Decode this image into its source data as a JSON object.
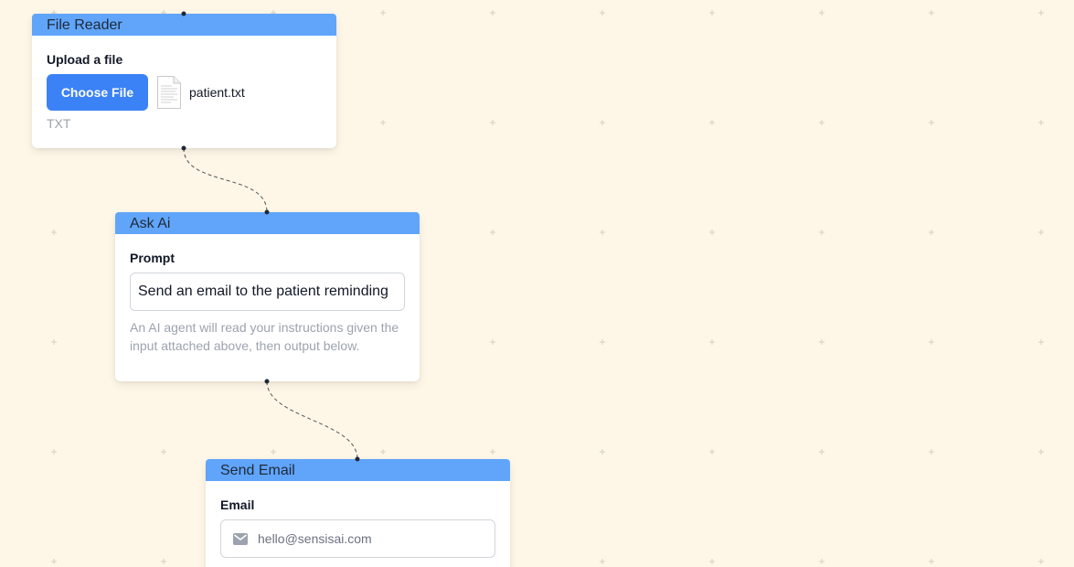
{
  "nodes": {
    "file_reader": {
      "title": "File Reader",
      "label": "Upload a file",
      "button_label": "Choose File",
      "file_icon": "document-icon",
      "file_name": "patient.txt",
      "file_type": "TXT"
    },
    "ask_ai": {
      "title": "Ask Ai",
      "label": "Prompt",
      "prompt_value": "Send an email to the patient reminding",
      "help_text": "An AI agent will read your instructions given the input attached above, then output below."
    },
    "send_email": {
      "title": "Send Email",
      "label": "Email",
      "email_icon": "mail-icon",
      "email_placeholder": "hello@sensisai.com"
    }
  },
  "colors": {
    "canvas_background": "#fef7e8",
    "node_header": "#60a5fa",
    "primary_button": "#3b82f6",
    "edge": "#555555"
  }
}
